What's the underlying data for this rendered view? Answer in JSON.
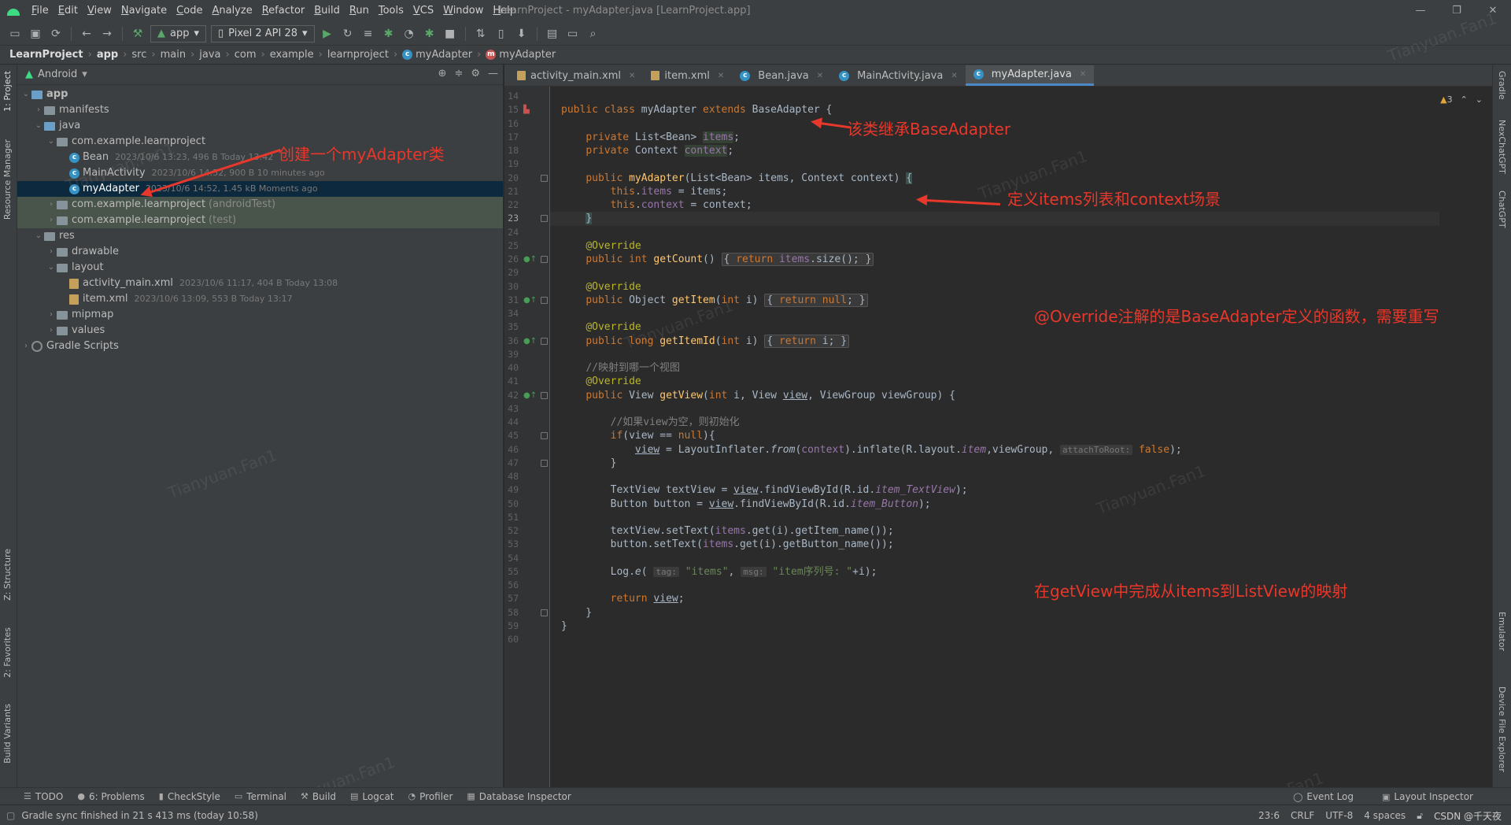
{
  "window": {
    "title": "LearnProject - myAdapter.java [LearnProject.app]",
    "controls": [
      "—",
      "❐",
      "✕"
    ]
  },
  "menu": [
    "File",
    "Edit",
    "View",
    "Navigate",
    "Code",
    "Analyze",
    "Refactor",
    "Build",
    "Run",
    "Tools",
    "VCS",
    "Window",
    "Help"
  ],
  "toolbar": {
    "run_config": "app",
    "device": "Pixel 2 API 28"
  },
  "breadcrumb": [
    "LearnProject",
    "app",
    "src",
    "main",
    "java",
    "com",
    "example",
    "learnproject",
    "myAdapter",
    "myAdapter"
  ],
  "project_panel": {
    "view_mode": "Android",
    "tree": [
      {
        "label": "app",
        "meta": "",
        "depth": 0,
        "kind": "module",
        "expanded": true
      },
      {
        "label": "manifests",
        "meta": "",
        "depth": 1,
        "kind": "folder",
        "expanded": false
      },
      {
        "label": "java",
        "meta": "",
        "depth": 1,
        "kind": "folder-blue",
        "expanded": true
      },
      {
        "label": "com.example.learnproject",
        "meta": "",
        "depth": 2,
        "kind": "package",
        "expanded": true
      },
      {
        "label": "Bean",
        "meta": "2023/10/6 13:23, 496 B Today 13:42",
        "depth": 3,
        "kind": "class"
      },
      {
        "label": "MainActivity",
        "meta": "2023/10/6 14:52, 900 B 10 minutes ago",
        "depth": 3,
        "kind": "class"
      },
      {
        "label": "myAdapter",
        "meta": "2023/10/6 14:52, 1.45 kB Moments ago",
        "depth": 3,
        "kind": "class",
        "selected": true
      },
      {
        "label": "com.example.learnproject",
        "meta": "(androidTest)",
        "depth": 2,
        "kind": "package",
        "expanded": false,
        "test": true
      },
      {
        "label": "com.example.learnproject",
        "meta": "(test)",
        "depth": 2,
        "kind": "package",
        "expanded": false,
        "test": true
      },
      {
        "label": "res",
        "meta": "",
        "depth": 1,
        "kind": "folder",
        "expanded": true
      },
      {
        "label": "drawable",
        "meta": "",
        "depth": 2,
        "kind": "folder",
        "expanded": false
      },
      {
        "label": "layout",
        "meta": "",
        "depth": 2,
        "kind": "folder",
        "expanded": true
      },
      {
        "label": "activity_main.xml",
        "meta": "2023/10/6 11:17, 404 B Today 13:08",
        "depth": 3,
        "kind": "xml"
      },
      {
        "label": "item.xml",
        "meta": "2023/10/6 13:09, 553 B Today 13:17",
        "depth": 3,
        "kind": "xml"
      },
      {
        "label": "mipmap",
        "meta": "",
        "depth": 2,
        "kind": "folder",
        "expanded": false
      },
      {
        "label": "values",
        "meta": "",
        "depth": 2,
        "kind": "folder",
        "expanded": false
      },
      {
        "label": "Gradle Scripts",
        "meta": "",
        "depth": 0,
        "kind": "gradle",
        "expanded": false
      }
    ]
  },
  "left_stripe": [
    "1: Project",
    "Resource Manager",
    "Z: Structure",
    "2: Favorites",
    "Build Variants"
  ],
  "right_stripe": [
    "Gradle",
    "NexChatGPT",
    "ChatGPT",
    "Emulator",
    "Device File Explorer"
  ],
  "editor_tabs": [
    {
      "label": "activity_main.xml",
      "type": "xml",
      "active": false
    },
    {
      "label": "item.xml",
      "type": "xml",
      "active": false
    },
    {
      "label": "Bean.java",
      "type": "class",
      "active": false
    },
    {
      "label": "MainActivity.java",
      "type": "class",
      "active": false
    },
    {
      "label": "myAdapter.java",
      "type": "class",
      "active": true
    }
  ],
  "inspection": {
    "warnings": "3"
  },
  "code_lines": [
    {
      "n": "14",
      "html": ""
    },
    {
      "n": "15",
      "html": "<span class='kw'>public class</span> myAdapter <span class='kw'>extends</span> BaseAdapter {"
    },
    {
      "n": "16",
      "html": ""
    },
    {
      "n": "17",
      "html": "    <span class='kw'>private</span> List&lt;Bean&gt; <span class='fld hl'>items</span>;"
    },
    {
      "n": "18",
      "html": "    <span class='kw'>private</span> Context <span class='fld hl'>context</span>;"
    },
    {
      "n": "19",
      "html": ""
    },
    {
      "n": "20",
      "html": "    <span class='kw'>public</span> <span class='fn'>myAdapter</span>(List&lt;Bean&gt; items, Context context) <span class='hlb'>{</span>"
    },
    {
      "n": "21",
      "html": "        <span class='kw'>this</span>.<span class='fld'>items</span> = items;"
    },
    {
      "n": "22",
      "html": "        <span class='kw'>this</span>.<span class='fld'>context</span> = context;"
    },
    {
      "n": "23",
      "html": "    <span class='hlb'>}</span>"
    },
    {
      "n": "24",
      "html": ""
    },
    {
      "n": "25",
      "html": "    <span class='ann'>@Override</span>"
    },
    {
      "n": "26",
      "html": "    <span class='kw'>public int</span> <span class='fn'>getCount</span>() <span class='fold-box'>{ <span class='kw'>return</span> <span class='fld'>items</span>.size(); }</span>"
    },
    {
      "n": "29",
      "html": ""
    },
    {
      "n": "30",
      "html": "    <span class='ann'>@Override</span>"
    },
    {
      "n": "31",
      "html": "    <span class='kw'>public</span> Object <span class='fn'>getItem</span>(<span class='kw'>int</span> i) <span class='fold-box'>{ <span class='kw'>return null</span>; }</span>"
    },
    {
      "n": "34",
      "html": ""
    },
    {
      "n": "35",
      "html": "    <span class='ann'>@Override</span>"
    },
    {
      "n": "36",
      "html": "    <span class='kw'>public long</span> <span class='fn'>getItemId</span>(<span class='kw'>int</span> i) <span class='fold-box'>{ <span class='kw'>return</span> i; }</span>"
    },
    {
      "n": "39",
      "html": ""
    },
    {
      "n": "40",
      "html": "    <span class='cmt'>//映射到哪一个视图</span>"
    },
    {
      "n": "41",
      "html": "    <span class='ann'>@Override</span>"
    },
    {
      "n": "42",
      "html": "    <span class='kw'>public</span> View <span class='fn'>getView</span>(<span class='kw'>int</span> i, View <span class='u'>view</span>, ViewGroup viewGroup) {"
    },
    {
      "n": "43",
      "html": ""
    },
    {
      "n": "44",
      "html": "        <span class='cmt'>//如果view为空，则初始化</span>"
    },
    {
      "n": "45",
      "html": "        <span class='kw'>if</span>(view == <span class='kw'>null</span>){"
    },
    {
      "n": "46",
      "html": "            <span class='u'>view</span> = LayoutInflater.<span class='ital'>from</span>(<span class='fld'>context</span>).inflate(R.layout.<span class='fld ital'>item</span>,viewGroup, <span class='hint'>attachToRoot:</span> <span class='kw'>false</span>);"
    },
    {
      "n": "47",
      "html": "        }"
    },
    {
      "n": "48",
      "html": ""
    },
    {
      "n": "49",
      "html": "        TextView textView = <span class='u'>view</span>.findViewById(R.id.<span class='fld ital'>item_TextView</span>);"
    },
    {
      "n": "50",
      "html": "        Button button = <span class='u'>view</span>.findViewById(R.id.<span class='fld ital'>item_Button</span>);"
    },
    {
      "n": "51",
      "html": ""
    },
    {
      "n": "52",
      "html": "        textView.setText(<span class='fld'>items</span>.get(i).getItem_name());"
    },
    {
      "n": "53",
      "html": "        button.setText(<span class='fld'>items</span>.get(i).getButton_name());"
    },
    {
      "n": "54",
      "html": ""
    },
    {
      "n": "55",
      "html": "        Log.<span class='ital'>e</span>( <span class='hint'>tag:</span> <span class='str'>\"items\"</span>, <span class='hint'>msg:</span> <span class='str'>\"item序列号: \"</span>+i);"
    },
    {
      "n": "56",
      "html": ""
    },
    {
      "n": "57",
      "html": "        <span class='kw'>return</span> <span class='u'>view</span>;"
    },
    {
      "n": "58",
      "html": "    }"
    },
    {
      "n": "59",
      "html": "}"
    },
    {
      "n": "60",
      "html": ""
    }
  ],
  "annotations": [
    "该类继承BaseAdapter",
    "创建一个myAdapter类",
    "定义items列表和context场景",
    "@Override注解的是BaseAdapter定义的函数，需要重写",
    "在getView中完成从items到ListView的映射"
  ],
  "watermark": "Tianyuan.Fan1",
  "bottom_tools": [
    "TODO",
    "6: Problems",
    "CheckStyle",
    "Terminal",
    "Build",
    "Logcat",
    "Profiler",
    "Database Inspector"
  ],
  "bottom_tools_right": [
    "Event Log",
    "Layout Inspector"
  ],
  "status": {
    "message": "Gradle sync finished in 21 s 413 ms (today 10:58)",
    "position": "23:6",
    "line_sep": "CRLF",
    "encoding": "UTF-8",
    "indent": "4 spaces",
    "csdn": "CSDN @千天夜"
  },
  "colors": {
    "accent": "#4a88c7",
    "annotation": "#e8372b",
    "bg": "#2b2b2b",
    "panel": "#3c3f41"
  }
}
